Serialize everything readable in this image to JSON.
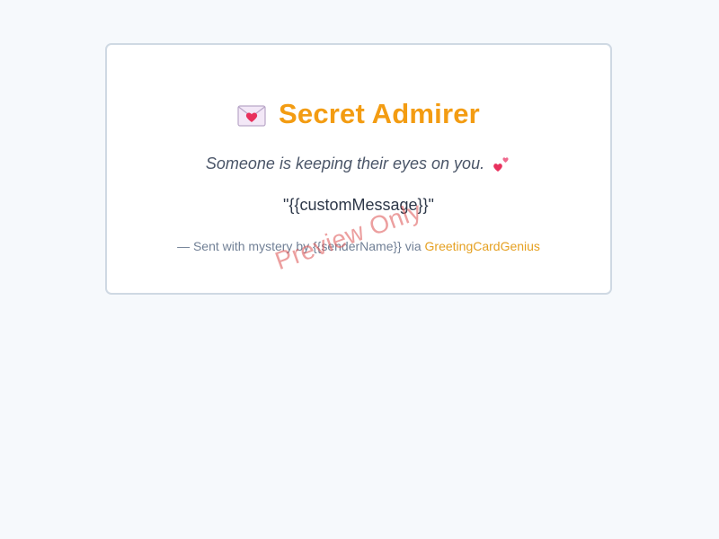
{
  "card": {
    "title": "Secret Admirer",
    "envelope_icon": "envelope-heart-icon",
    "subtitle": "Someone is keeping their eyes on you.",
    "hearts_icon": "two-hearts-icon",
    "message": "\"{{customMessage}}\"",
    "footer_prefix": "— Sent with mystery by {{senderName}} via ",
    "footer_link": "GreetingCardGenius"
  },
  "watermark": "Preview Only",
  "colors": {
    "accent": "#f39c12",
    "link": "#e5a021",
    "heart": "#e8315d",
    "background": "#f6f9fc",
    "card_border": "#cfd9e3",
    "watermark": "#dc5050"
  }
}
